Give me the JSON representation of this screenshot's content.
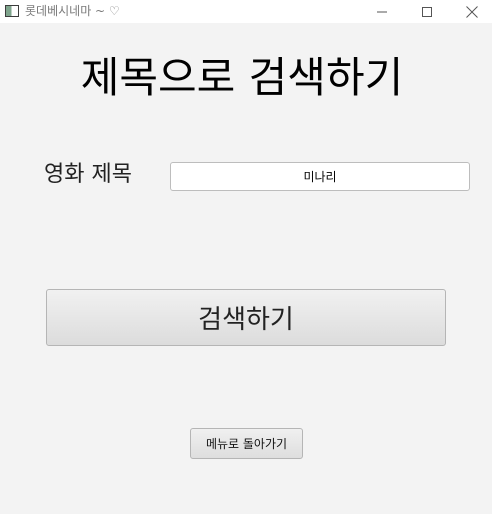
{
  "window": {
    "title": "롯데베시네마 ~ ♡",
    "icon": "app-window-icon",
    "controls": [
      "minimize-icon",
      "maximize-icon",
      "close-icon"
    ]
  },
  "page": {
    "heading": "제목으로 검색하기"
  },
  "form": {
    "movie_title_label": "영화 제목",
    "movie_title_value": "미나리",
    "search_button_label": "검색하기"
  },
  "footer": {
    "back_to_menu_label": "메뉴로 돌아가기"
  },
  "colors": {
    "window_background": "#f3f3f3",
    "titlebar_background": "#ffffff",
    "button_gradient_top": "#f1f1f1",
    "button_gradient_bottom": "#dcdcdc"
  }
}
